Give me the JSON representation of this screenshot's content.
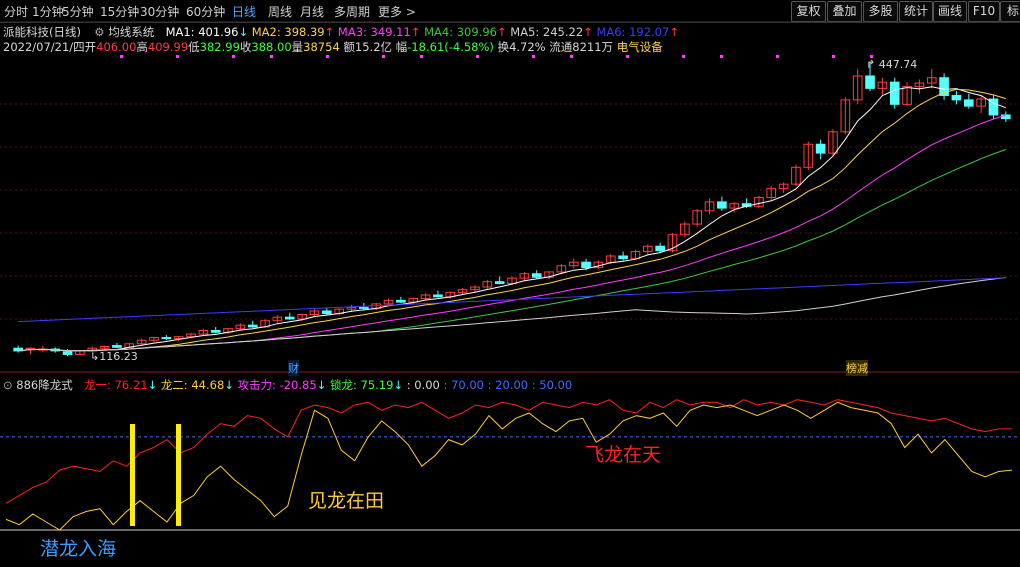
{
  "toolbar": {
    "periods": [
      "分时",
      "1分钟",
      "5分钟",
      "15分钟",
      "30分钟",
      "60分钟",
      "日线",
      "周线",
      "月线",
      "多周期",
      "更多 >"
    ],
    "active": "日线",
    "right_buttons": [
      "复权",
      "叠加",
      "多股",
      "统计",
      "画线",
      "F10",
      "标"
    ]
  },
  "stock": {
    "name": "派能科技(日线)",
    "system": "均线系统",
    "ma1": "MA1: 401.96",
    "ma2": "MA2: 398.39",
    "ma3": "MA3: 349.11",
    "ma4": "MA4: 309.96",
    "ma5": "MA5: 245.22",
    "ma6": "MA6: 192.07",
    "date": "2022/07/21/四",
    "open_label": "开",
    "open": "406.00",
    "high_label": "高",
    "high": "409.99",
    "low_label": "低",
    "low": "382.99",
    "close_label": "收",
    "close": "388.00",
    "vol_label": "量",
    "vol": "38754",
    "amount": "额15.2亿",
    "change_label": "幅",
    "change": "-18.61(-4.58%)",
    "turnover": "换4.72%",
    "float_cap": "流通8211万",
    "industry": "电气设备"
  },
  "main_chart": {
    "high_marker": "447.74",
    "low_marker": "116.23",
    "tag_cai": "财",
    "tag_bangjian": "榜减"
  },
  "indicator": {
    "name": "886降龙式",
    "long1": "龙一: 76.21",
    "long2": "龙二: 44.68",
    "attack": "攻击力: -20.85",
    "suolong": "锁龙: 75.19",
    "v0": ": 0.00",
    "v70": ": 70.00",
    "v20": ": 20.00",
    "v50": ": 50.00",
    "label_qianlong": "潜龙入海",
    "label_jianlong": "见龙在田",
    "label_feilong": "飞龙在天"
  },
  "colors": {
    "up": "#ff3c3c",
    "down": "#54ffff",
    "ma1": "#ffffff",
    "ma2": "#ffd34a",
    "ma3": "#ff3cff",
    "ma4": "#3cc83c",
    "ma5": "#d0d0d0",
    "ma6": "#3c3cff",
    "long1": "#ff2020",
    "long2": "#ffcc33",
    "attack": "#ff3cff",
    "suolong": "#3cff3c",
    "blue": "#3c6cff"
  },
  "chart_data": {
    "type": "line",
    "main_range": [
      116.23,
      447.74
    ],
    "candles": [
      [
        125,
        128,
        120,
        122
      ],
      [
        124,
        126,
        118,
        125
      ],
      [
        123,
        128,
        121,
        124
      ],
      [
        124,
        126,
        120,
        122
      ],
      [
        121,
        124,
        116,
        118
      ],
      [
        118,
        123,
        117,
        122
      ],
      [
        122,
        127,
        121,
        125
      ],
      [
        125,
        128,
        123,
        127
      ],
      [
        128,
        131,
        125,
        126
      ],
      [
        126,
        131,
        125,
        130
      ],
      [
        130,
        136,
        129,
        134
      ],
      [
        134,
        138,
        132,
        137
      ],
      [
        137,
        140,
        134,
        136
      ],
      [
        136,
        139,
        133,
        138
      ],
      [
        138,
        142,
        136,
        141
      ],
      [
        141,
        147,
        139,
        145
      ],
      [
        145,
        149,
        142,
        143
      ],
      [
        143,
        148,
        141,
        147
      ],
      [
        147,
        153,
        145,
        151
      ],
      [
        151,
        156,
        148,
        149
      ],
      [
        149,
        158,
        148,
        156
      ],
      [
        156,
        162,
        154,
        160
      ],
      [
        160,
        165,
        157,
        158
      ],
      [
        158,
        164,
        156,
        163
      ],
      [
        163,
        169,
        161,
        167
      ],
      [
        167,
        171,
        163,
        164
      ],
      [
        164,
        170,
        162,
        169
      ],
      [
        169,
        174,
        166,
        171
      ],
      [
        171,
        176,
        168,
        170
      ],
      [
        170,
        176,
        168,
        175
      ],
      [
        175,
        181,
        173,
        179
      ],
      [
        179,
        183,
        176,
        177
      ],
      [
        177,
        182,
        175,
        181
      ],
      [
        181,
        187,
        179,
        185
      ],
      [
        185,
        190,
        182,
        183
      ],
      [
        183,
        189,
        181,
        188
      ],
      [
        188,
        193,
        185,
        191
      ],
      [
        191,
        196,
        188,
        194
      ],
      [
        194,
        202,
        192,
        200
      ],
      [
        200,
        206,
        197,
        198
      ],
      [
        198,
        206,
        196,
        204
      ],
      [
        204,
        211,
        201,
        209
      ],
      [
        209,
        213,
        203,
        205
      ],
      [
        205,
        212,
        203,
        211
      ],
      [
        211,
        220,
        209,
        218
      ],
      [
        218,
        226,
        215,
        222
      ],
      [
        222,
        226,
        213,
        216
      ],
      [
        216,
        224,
        214,
        222
      ],
      [
        222,
        231,
        220,
        229
      ],
      [
        229,
        234,
        224,
        226
      ],
      [
        226,
        236,
        225,
        234
      ],
      [
        234,
        242,
        231,
        240
      ],
      [
        240,
        244,
        233,
        235
      ],
      [
        235,
        255,
        233,
        253
      ],
      [
        253,
        268,
        250,
        265
      ],
      [
        265,
        282,
        262,
        280
      ],
      [
        280,
        294,
        276,
        290
      ],
      [
        290,
        296,
        280,
        283
      ],
      [
        283,
        290,
        278,
        288
      ],
      [
        288,
        294,
        283,
        285
      ],
      [
        285,
        297,
        283,
        295
      ],
      [
        295,
        308,
        292,
        305
      ],
      [
        305,
        312,
        300,
        310
      ],
      [
        310,
        332,
        308,
        329
      ],
      [
        329,
        358,
        326,
        355
      ],
      [
        355,
        360,
        338,
        345
      ],
      [
        345,
        372,
        342,
        369
      ],
      [
        369,
        408,
        366,
        405
      ],
      [
        405,
        440,
        400,
        432
      ],
      [
        432,
        447.74,
        415,
        418
      ],
      [
        418,
        430,
        410,
        425
      ],
      [
        425,
        430,
        395,
        400
      ],
      [
        400,
        425,
        398,
        420
      ],
      [
        420,
        428,
        412,
        424
      ],
      [
        424,
        440,
        418,
        430
      ],
      [
        430,
        435,
        405,
        410
      ],
      [
        410,
        415,
        400,
        405
      ],
      [
        405,
        412,
        395,
        398
      ],
      [
        398,
        410,
        390,
        406
      ],
      [
        406,
        409.99,
        382.99,
        388
      ],
      [
        388,
        392,
        380,
        384
      ]
    ],
    "indicator_lines": {
      "long1": [
        20,
        26,
        32,
        36,
        45,
        48,
        46,
        44,
        52,
        48,
        58,
        62,
        68,
        58,
        62,
        72,
        80,
        78,
        86,
        84,
        76,
        70,
        90,
        94,
        92,
        88,
        94,
        96,
        90,
        94,
        92,
        96,
        90,
        84,
        88,
        94,
        92,
        96,
        94,
        90,
        96,
        94,
        92,
        96,
        94,
        98,
        90,
        88,
        96,
        92,
        98,
        94,
        96,
        96,
        92,
        98,
        94,
        96,
        94,
        98,
        96,
        94,
        98,
        96,
        94,
        92,
        88,
        86,
        84,
        82,
        84,
        80,
        76,
        74,
        76,
        76
      ],
      "long2": [
        8,
        4,
        12,
        6,
        0,
        10,
        14,
        16,
        4,
        14,
        22,
        14,
        6,
        20,
        26,
        40,
        48,
        38,
        30,
        22,
        10,
        18,
        56,
        90,
        84,
        60,
        52,
        70,
        82,
        74,
        64,
        48,
        56,
        68,
        64,
        72,
        86,
        76,
        84,
        88,
        80,
        74,
        82,
        84,
        66,
        72,
        82,
        86,
        84,
        88,
        78,
        90,
        94,
        92,
        94,
        90,
        86,
        90,
        94,
        90,
        84,
        90,
        96,
        92,
        90,
        88,
        80,
        62,
        72,
        58,
        68,
        56,
        44,
        40,
        44,
        45
      ]
    }
  }
}
